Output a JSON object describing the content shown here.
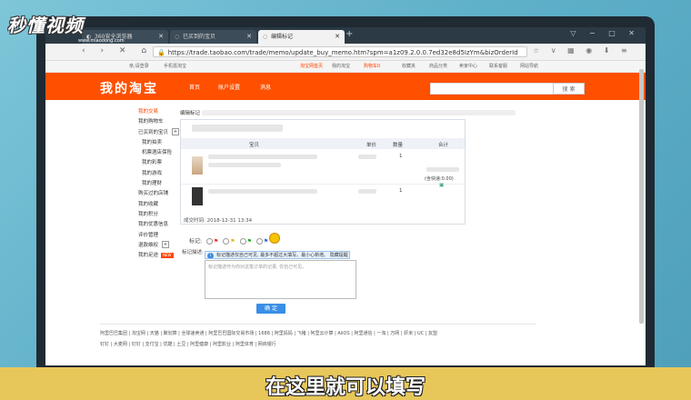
{
  "watermark": {
    "logo": "秒懂视频",
    "sub": "www.miaodong.com"
  },
  "browser": {
    "tabs": [
      {
        "label": "360安全浏览器"
      },
      {
        "label": "已买到的宝贝"
      },
      {
        "label": "编辑标记"
      }
    ],
    "url": "https://trade.taobao.com/trade/memo/update_buy_memo.htm?spm=a1z09.2.0.0.7ed32e8d5IzYm&bizOrderId",
    "new_tab": "+",
    "window_controls": "▽ − □ ✕",
    "nav_buttons": "‹ › ✕ ⌂ ↻",
    "extra_icons": "☆ ∨ ▦ ◉ ⬇ ≡"
  },
  "taobao_top": {
    "login": "亲,请登录",
    "mobile": "手机逛淘宝",
    "home": "淘宝网首页",
    "my": "我的淘宝",
    "cart": "购物车0",
    "fav": "收藏夹",
    "goods": "商品分类",
    "seller": "卖家中心",
    "service": "联系客服",
    "sitemap": "网站导航"
  },
  "header": {
    "title": "我的淘宝",
    "nav": [
      "首页",
      "账户设置",
      "消息"
    ],
    "search_button": "搜 索"
  },
  "sidebar": {
    "items": [
      {
        "label": "我的交易",
        "red": true
      },
      {
        "label": "我的购物车"
      },
      {
        "label": "已买到的宝贝",
        "plus": true
      },
      {
        "label": "我的拍卖",
        "sub": true
      },
      {
        "label": "机票酒店保险",
        "sub": true
      },
      {
        "label": "我的彩票",
        "sub": true
      },
      {
        "label": "我的游戏",
        "sub": true
      },
      {
        "label": "我的理财",
        "sub": true
      },
      {
        "label": "购买过的店铺"
      },
      {
        "label": "我的收藏"
      },
      {
        "label": "我的积分"
      },
      {
        "label": "我的优惠信息"
      },
      {
        "label": "评价管理"
      },
      {
        "label": "退款维权",
        "plus": true
      },
      {
        "label": "我的足迹",
        "badge": "NEW"
      }
    ]
  },
  "content": {
    "crumb": "编辑标记",
    "table_headers": [
      "宝贝",
      "单价",
      "数量",
      "合计"
    ],
    "row1": {
      "qty": "1",
      "shipping": "(含快递:0.00)"
    },
    "row2": {
      "qty": "1"
    },
    "order_time": "成交时间: 2018-12-31 13:34",
    "mark_label": "标记:",
    "memo_label": "标记描述:",
    "tip": "标记描述仅自己可见, 最多不超过大填写。最小心新增。 隐藏提醒",
    "memo_placeholder": "标记描述作为你对这笔订单的记录, 仅自己可见。",
    "confirm": "确 定"
  },
  "footer": {
    "line1": "阿里巴巴集团 | 淘宝网 | 天猫 | 聚划算 | 全球速卖通 | 阿里巴巴国际交易市场 | 1688 | 阿里妈妈 | 飞猪 | 阿里云计算 | AliOS | 阿里通信 | 一淘 | 万网 | 虾米 | UC | 友盟",
    "line2": "钉钉 | 大麦网 | 钉钉 | 支付宝 | 优酷 | 土豆 | 阿里健康 | 阿里影业 | 阿里体育 | 网商银行"
  },
  "caption": "在这里就可以填写"
}
